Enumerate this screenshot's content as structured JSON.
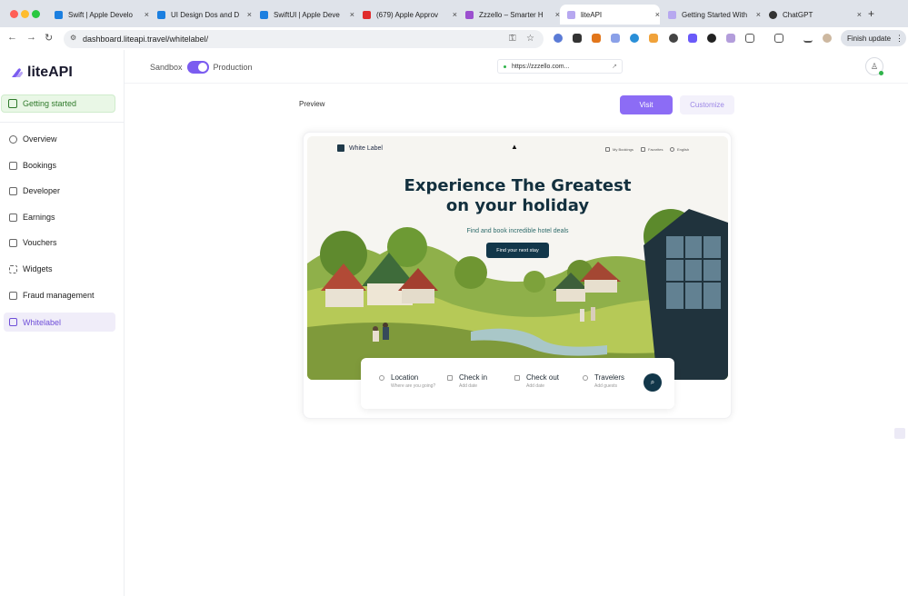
{
  "browser": {
    "tabs": [
      {
        "title": "Swift | Apple Develo",
        "close": "×",
        "favicon": "#1b7fe0"
      },
      {
        "title": "UI Design Dos and D",
        "close": "×",
        "favicon": "#1b7fe0"
      },
      {
        "title": "SwiftUI | Apple Deve",
        "close": "×",
        "favicon": "#1b7fe0"
      },
      {
        "title": "(679) Apple Approv",
        "close": "×",
        "favicon": "#e02b2b"
      },
      {
        "title": "Zzzello – Smarter H",
        "close": "×",
        "favicon": "#9b4fcf"
      },
      {
        "title": "liteAPI",
        "close": "×",
        "favicon": "#b7a8f0"
      },
      {
        "title": "Getting Started With",
        "close": "×",
        "favicon": "#b7a8f0"
      },
      {
        "title": "ChatGPT",
        "close": "×",
        "favicon": "#333333"
      }
    ],
    "new_tab": "+",
    "url": "dashboard.liteapi.travel/whitelabel/",
    "finish_update": "Finish update",
    "menu_icon": "⋮"
  },
  "sidebar": {
    "logo": "liteAPI",
    "getting_started": "Getting started",
    "items": [
      {
        "label": "Overview"
      },
      {
        "label": "Bookings"
      },
      {
        "label": "Developer"
      },
      {
        "label": "Earnings"
      },
      {
        "label": "Vouchers"
      },
      {
        "label": "Widgets"
      },
      {
        "label": "Fraud management"
      },
      {
        "label": "Whitelabel"
      }
    ]
  },
  "topbar": {
    "sandbox": "Sandbox",
    "production": "Production",
    "site_url": "https://zzzello.com..."
  },
  "main": {
    "preview_label": "Preview",
    "visit": "Visit",
    "customize": "Customize"
  },
  "preview": {
    "brand": "White Label",
    "menu": [
      "My Bookings",
      "Favorites",
      "English"
    ],
    "headline_1": "Experience The Greatest",
    "headline_2": "on your holiday",
    "subtitle": "Find and book incredible hotel deals",
    "cta": "Find your next stay",
    "search": {
      "location": {
        "title": "Location",
        "sub": "Where are you going?"
      },
      "checkin": {
        "title": "Check in",
        "sub": "Add date"
      },
      "checkout": {
        "title": "Check out",
        "sub": "Add date"
      },
      "travelers": {
        "title": "Travelers",
        "sub": "Add guests"
      }
    }
  },
  "colors": {
    "accent": "#8c6cf5",
    "green": "#2f7a2b",
    "navy": "#12374a"
  }
}
